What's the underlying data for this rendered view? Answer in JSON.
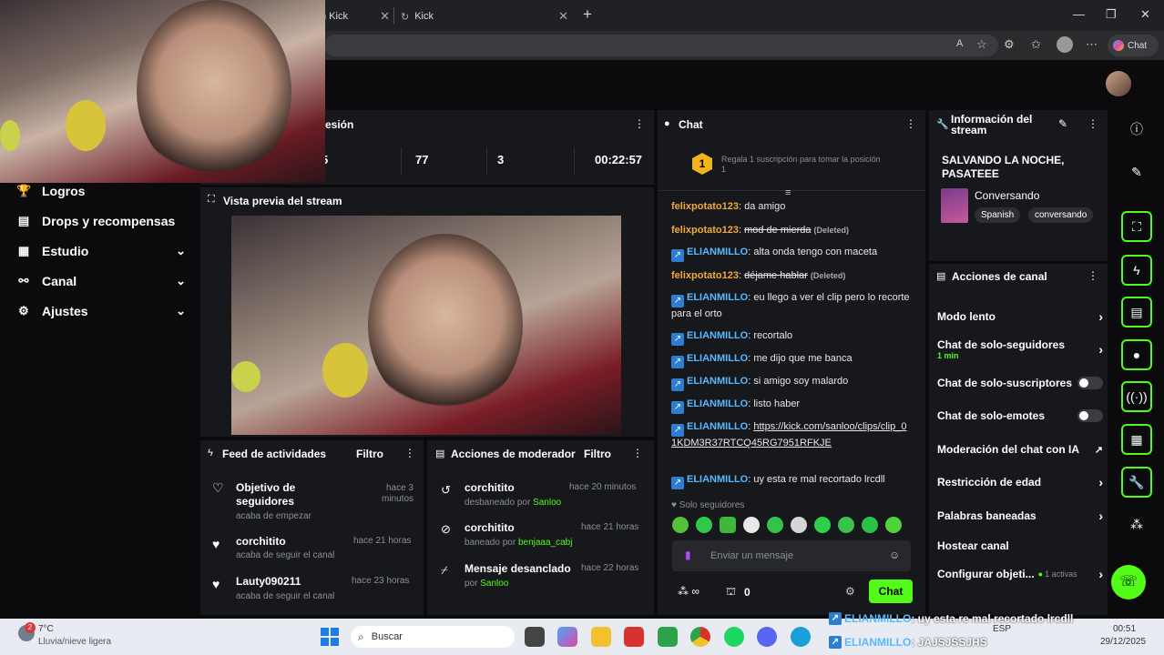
{
  "browser": {
    "tabs": [
      {
        "label": "n Kick"
      },
      {
        "label": "Kick"
      }
    ],
    "copilot_label": "Chat"
  },
  "sidebar": {
    "items": [
      {
        "label": "Logros",
        "icon": "trophy-icon"
      },
      {
        "label": "Drops y recompensas",
        "icon": "drops-icon"
      },
      {
        "label": "Estudio",
        "icon": "studio-icon"
      },
      {
        "label": "Canal",
        "icon": "channel-icon"
      },
      {
        "label": "Ajustes",
        "icon": "gear-icon"
      }
    ]
  },
  "session": {
    "title": "esión",
    "stats": [
      {
        "value": "5"
      },
      {
        "value": "77"
      },
      {
        "value": "3"
      },
      {
        "value": "00:22:57"
      }
    ]
  },
  "preview": {
    "title": "Vista previa del stream"
  },
  "activity": {
    "title": "Feed de actividades",
    "filter": "Filtro",
    "items": [
      {
        "title": "Objetivo de seguidores",
        "sub": "acaba de empezar",
        "time": "hace 3 minutos"
      },
      {
        "title": "corchitito",
        "sub": "acaba de seguir el canal",
        "time": "hace 21 horas"
      },
      {
        "title": "Lauty090211",
        "sub": "acaba de seguir el canal",
        "time": "hace 23 horas"
      }
    ]
  },
  "modactions": {
    "title": "Acciones de moderador",
    "filter": "Filtro",
    "items": [
      {
        "title": "corchitito",
        "sub_prefix": "desbaneado por",
        "sub_user": "Sanloo",
        "time": "hace 20 minutos"
      },
      {
        "title": "corchitito",
        "sub_prefix": "baneado por",
        "sub_user": "benjaaa_cabj",
        "time": "hace 21 horas"
      },
      {
        "title": "Mensaje desanclado",
        "sub_prefix": "por",
        "sub_user": "Sanloo",
        "time": "hace 22 horas"
      }
    ]
  },
  "chat": {
    "title": "Chat",
    "gift_rank": "1",
    "gift_text": "Regala 1 suscripción para tomar la posición 1",
    "messages": [
      {
        "user": "felixpotato123",
        "color": "orange",
        "text": "da amigo",
        "deleted": ""
      },
      {
        "user": "felixpotato123",
        "color": "orange",
        "text": "mod de mierda",
        "deleted": "(Deleted)"
      },
      {
        "user": "ELIANMILLO",
        "color": "blue",
        "text": "alta onda tengo con maceta",
        "deleted": ""
      },
      {
        "user": "felixpotato123",
        "color": "orange",
        "text": "déjame hablar",
        "deleted": "(Deleted)"
      },
      {
        "user": "ELIANMILLO",
        "color": "blue",
        "text": "eu llego a ver el clip pero lo recorte para el orto",
        "deleted": ""
      },
      {
        "user": "ELIANMILLO",
        "color": "blue",
        "text": "recortalo",
        "deleted": ""
      },
      {
        "user": "ELIANMILLO",
        "color": "blue",
        "text": "me dijo que me banca",
        "deleted": ""
      },
      {
        "user": "ELIANMILLO",
        "color": "blue",
        "text": "si amigo soy malardo",
        "deleted": ""
      },
      {
        "user": "ELIANMILLO",
        "color": "blue",
        "text": "listo haber",
        "deleted": ""
      },
      {
        "user": "ELIANMILLO",
        "color": "blue",
        "text": "https://kick.com/sanloo/clips/clip_01KDM3R37RTCQ45RG7951RFKJE",
        "deleted": ""
      },
      {
        "user": "ELIANMILLO",
        "color": "blue",
        "text": "uy esta re mal recortado lrcdll",
        "deleted": ""
      }
    ],
    "followers_only": "Solo seguidores",
    "input_placeholder": "Enviar un mensaje",
    "points": "0",
    "send_label": "Chat"
  },
  "streaminfo": {
    "title": "Información del stream",
    "stream_title": "SALVANDO LA NOCHE, PASATEEE",
    "category": "Conversando",
    "tags": [
      "Spanish",
      "conversando"
    ]
  },
  "channelactions": {
    "title": "Acciones de canal",
    "items": [
      {
        "label": "Modo lento",
        "kind": "chevron"
      },
      {
        "label": "Chat de solo-seguidores",
        "sub": "1 min",
        "kind": "chevron"
      },
      {
        "label": "Chat de solo-suscriptores",
        "kind": "toggle"
      },
      {
        "label": "Chat de solo-emotes",
        "kind": "toggle"
      },
      {
        "label": "Moderación del chat con IA",
        "kind": "external"
      },
      {
        "label": "Restricción de edad",
        "kind": "chevron"
      },
      {
        "label": "Palabras baneadas",
        "kind": "chevron"
      },
      {
        "label": "Hostear canal",
        "kind": "none"
      },
      {
        "label": "Configurar objeti...",
        "sub": "1 activas",
        "kind": "chevron"
      }
    ]
  },
  "overlay_chat": [
    {
      "user": "ELIANMILLO",
      "text": ": uy esta re mal recortado lrcdll"
    },
    {
      "user": "ELIANMILLO",
      "text": ": JAJSJSSJHS"
    }
  ],
  "taskbar": {
    "weather_temp": "7°C",
    "weather_desc": "Lluvia/nieve ligera",
    "weather_badge": "2",
    "search_label": "Buscar",
    "lang": "ESP",
    "time": "00:51",
    "date": "29/12/2025"
  },
  "colors": {
    "accent": "#53fc18",
    "panel": "#17181c",
    "background": "#0b0b0d"
  }
}
